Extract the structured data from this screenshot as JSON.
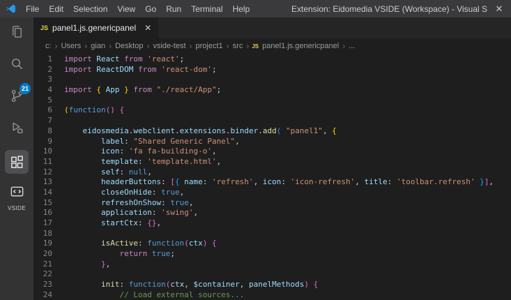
{
  "window": {
    "title": "Extension: Eidomedia VSIDE (Workspace) - Visual S",
    "close_glyph": "✕"
  },
  "menu_bar": {
    "items": [
      "File",
      "Edit",
      "Selection",
      "View",
      "Go",
      "Run",
      "Terminal",
      "Help"
    ]
  },
  "activity_bar": {
    "scm_badge": "21",
    "vside_label": "VSIDE"
  },
  "tab": {
    "icon": "JS",
    "label": "panel1.js.genericpanel",
    "close_glyph": "✕"
  },
  "breadcrumb": {
    "separator": "›",
    "items": [
      "c:",
      "Users",
      "gian",
      "Desktop",
      "vside-test",
      "project1",
      "src"
    ],
    "file_icon": "JS",
    "file": "panel1.js.genericpanel",
    "overflow": "..."
  },
  "editor": {
    "lines": [
      {
        "n": "1",
        "t": [
          [
            "kw",
            "import"
          ],
          [
            "vr",
            " React"
          ],
          [
            "kw",
            " from"
          ],
          [
            "st",
            " 'react'"
          ],
          [
            "pn",
            ";"
          ]
        ]
      },
      {
        "n": "2",
        "t": [
          [
            "kw",
            "import"
          ],
          [
            "vr",
            " ReactDOM"
          ],
          [
            "kw",
            " from"
          ],
          [
            "st",
            " 'react-dom'"
          ],
          [
            "pn",
            ";"
          ]
        ]
      },
      {
        "n": "3",
        "t": []
      },
      {
        "n": "4",
        "t": [
          [
            "kw",
            "import"
          ],
          [
            "b1",
            " {"
          ],
          [
            "vr",
            " App"
          ],
          [
            "b1",
            " }"
          ],
          [
            "kw",
            " from"
          ],
          [
            "st",
            " \"./react/App\""
          ],
          [
            "pn",
            ";"
          ]
        ]
      },
      {
        "n": "5",
        "t": []
      },
      {
        "n": "6",
        "t": [
          [
            "b1",
            "("
          ],
          [
            "kw2",
            "function"
          ],
          [
            "b2",
            "()"
          ],
          [
            "b2",
            " {"
          ]
        ]
      },
      {
        "n": "7",
        "t": []
      },
      {
        "n": "8",
        "t": [
          [
            "pn",
            "    "
          ],
          [
            "vr",
            "eidosmedia"
          ],
          [
            "pn",
            "."
          ],
          [
            "vr",
            "webclient"
          ],
          [
            "pn",
            "."
          ],
          [
            "vr",
            "extensions"
          ],
          [
            "pn",
            "."
          ],
          [
            "vr",
            "binder"
          ],
          [
            "pn",
            "."
          ],
          [
            "fn",
            "add"
          ],
          [
            "b3",
            "("
          ],
          [
            "st",
            " \"panel1\""
          ],
          [
            "pn",
            ","
          ],
          [
            "b1",
            " {"
          ]
        ]
      },
      {
        "n": "9",
        "t": [
          [
            "pn",
            "        "
          ],
          [
            "vr",
            "label"
          ],
          [
            "pn",
            ":"
          ],
          [
            "st",
            " \"Shared Generic Panel\""
          ],
          [
            "pn",
            ","
          ]
        ]
      },
      {
        "n": "10",
        "t": [
          [
            "pn",
            "        "
          ],
          [
            "vr",
            "icon"
          ],
          [
            "pn",
            ":"
          ],
          [
            "st",
            " 'fa fa-building-o'"
          ],
          [
            "pn",
            ","
          ]
        ]
      },
      {
        "n": "11",
        "t": [
          [
            "pn",
            "        "
          ],
          [
            "vr",
            "template"
          ],
          [
            "pn",
            ":"
          ],
          [
            "st",
            " 'template.html'"
          ],
          [
            "pn",
            ","
          ]
        ]
      },
      {
        "n": "12",
        "t": [
          [
            "pn",
            "        "
          ],
          [
            "vr",
            "self"
          ],
          [
            "pn",
            ":"
          ],
          [
            "kw2",
            " null"
          ],
          [
            "pn",
            ","
          ]
        ]
      },
      {
        "n": "13",
        "t": [
          [
            "pn",
            "        "
          ],
          [
            "vr",
            "headerButtons"
          ],
          [
            "pn",
            ":"
          ],
          [
            "b2",
            " ["
          ],
          [
            "b3",
            "{"
          ],
          [
            "vr",
            " name"
          ],
          [
            "pn",
            ":"
          ],
          [
            "st",
            " 'refresh'"
          ],
          [
            "pn",
            ","
          ],
          [
            "vr",
            " icon"
          ],
          [
            "pn",
            ":"
          ],
          [
            "st",
            " 'icon-refresh'"
          ],
          [
            "pn",
            ","
          ],
          [
            "vr",
            " title"
          ],
          [
            "pn",
            ":"
          ],
          [
            "st",
            " 'toolbar.refresh'"
          ],
          [
            "b3",
            " }"
          ],
          [
            "b2",
            "]"
          ],
          [
            "pn",
            ","
          ]
        ]
      },
      {
        "n": "14",
        "t": [
          [
            "pn",
            "        "
          ],
          [
            "vr",
            "closeOnHide"
          ],
          [
            "pn",
            ":"
          ],
          [
            "kw2",
            " true"
          ],
          [
            "pn",
            ","
          ]
        ]
      },
      {
        "n": "15",
        "t": [
          [
            "pn",
            "        "
          ],
          [
            "vr",
            "refreshOnShow"
          ],
          [
            "pn",
            ":"
          ],
          [
            "kw2",
            " true"
          ],
          [
            "pn",
            ","
          ]
        ]
      },
      {
        "n": "16",
        "t": [
          [
            "pn",
            "        "
          ],
          [
            "vr",
            "application"
          ],
          [
            "pn",
            ":"
          ],
          [
            "st",
            " 'swing'"
          ],
          [
            "pn",
            ","
          ]
        ]
      },
      {
        "n": "17",
        "t": [
          [
            "pn",
            "        "
          ],
          [
            "vr",
            "startCtx"
          ],
          [
            "pn",
            ":"
          ],
          [
            "b2",
            " {}"
          ],
          [
            "pn",
            ","
          ]
        ]
      },
      {
        "n": "18",
        "t": []
      },
      {
        "n": "19",
        "t": [
          [
            "pn",
            "        "
          ],
          [
            "fn",
            "isActive"
          ],
          [
            "pn",
            ":"
          ],
          [
            "kw2",
            " function"
          ],
          [
            "b2",
            "("
          ],
          [
            "vr",
            "ctx"
          ],
          [
            "b2",
            ")"
          ],
          [
            "b2",
            " {"
          ]
        ]
      },
      {
        "n": "20",
        "t": [
          [
            "pn",
            "            "
          ],
          [
            "kw",
            "return"
          ],
          [
            "kw2",
            " true"
          ],
          [
            "pn",
            ";"
          ]
        ]
      },
      {
        "n": "21",
        "t": [
          [
            "pn",
            "        "
          ],
          [
            "b2",
            "}"
          ],
          [
            "pn",
            ","
          ]
        ]
      },
      {
        "n": "22",
        "t": []
      },
      {
        "n": "23",
        "t": [
          [
            "pn",
            "        "
          ],
          [
            "fn",
            "init"
          ],
          [
            "pn",
            ":"
          ],
          [
            "kw2",
            " function"
          ],
          [
            "b2",
            "("
          ],
          [
            "vr",
            "ctx"
          ],
          [
            "pn",
            ", "
          ],
          [
            "vr",
            "$container"
          ],
          [
            "pn",
            ", "
          ],
          [
            "vr",
            "panelMethods"
          ],
          [
            "b2",
            ")"
          ],
          [
            "b2",
            " {"
          ]
        ]
      },
      {
        "n": "24",
        "t": [
          [
            "pn",
            "            "
          ],
          [
            "cm",
            "// Load external sources..."
          ]
        ]
      }
    ]
  },
  "colors": {
    "keyword_control": "#C586C0",
    "keyword_storage": "#569CD6",
    "string": "#CE9178",
    "variable": "#9CDCFE",
    "function_name": "#DCDCAA",
    "comment": "#6A9955",
    "badge": "#007ACC",
    "js_icon": "#E8D44D",
    "editor_bg": "#1E1E1E",
    "activity_bar_bg": "#333333",
    "titlebar_bg": "#3A3A3D",
    "tabbar_bg": "#252526"
  }
}
